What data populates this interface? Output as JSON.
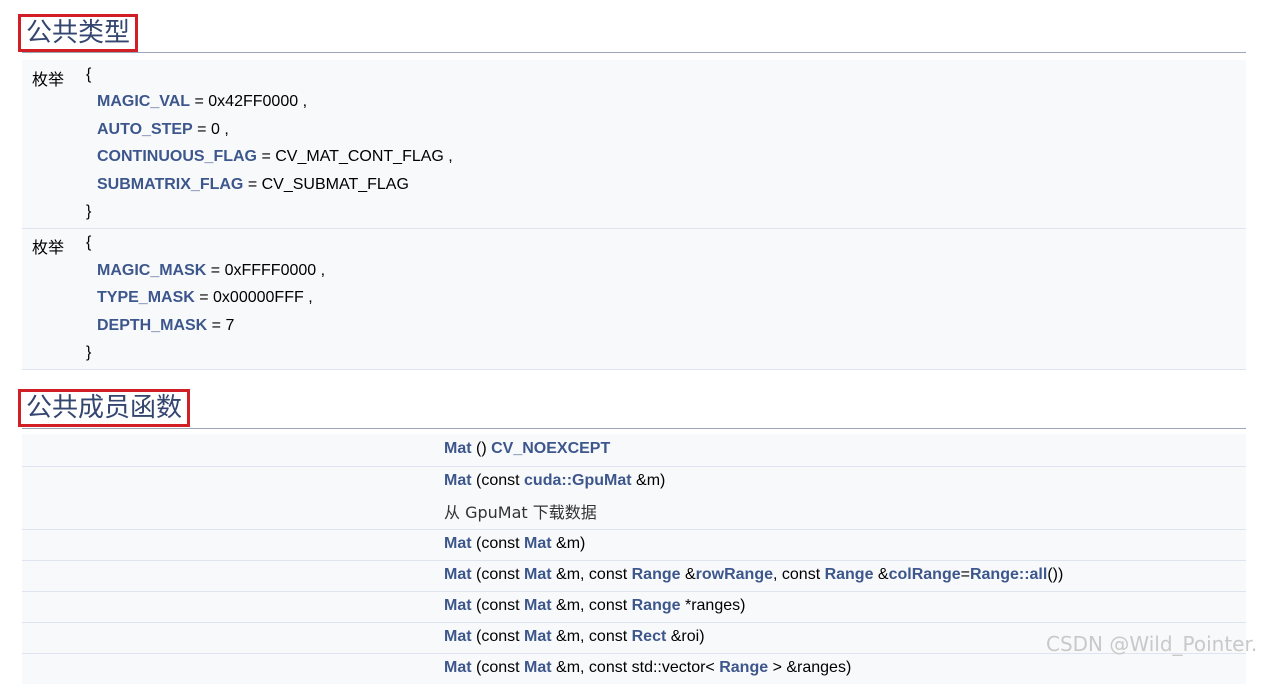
{
  "sections": {
    "types_title": "公共类型",
    "functions_title": "公共成员函数"
  },
  "enum1": {
    "keyword": "枚举",
    "open": "{",
    "close": "}",
    "items": [
      {
        "name": "MAGIC_VAL",
        "rest": " = 0x42FF0000 ,"
      },
      {
        "name": "AUTO_STEP",
        "rest": " = 0 ,"
      },
      {
        "name": "CONTINUOUS_FLAG",
        "rest": " = CV_MAT_CONT_FLAG ,"
      },
      {
        "name": "SUBMATRIX_FLAG",
        "rest": " = CV_SUBMAT_FLAG"
      }
    ]
  },
  "enum2": {
    "keyword": "枚举",
    "open": "{",
    "close": "}",
    "items": [
      {
        "name": "MAGIC_MASK",
        "rest": " = 0xFFFF0000 ,"
      },
      {
        "name": "TYPE_MASK",
        "rest": " = 0x00000FFF ,"
      },
      {
        "name": "DEPTH_MASK",
        "rest": " = 7"
      }
    ]
  },
  "functions": {
    "rows": [
      {
        "parts": [
          [
            "Mat",
            true
          ],
          [
            " () ",
            false
          ],
          [
            "CV_NOEXCEPT",
            true
          ]
        ]
      },
      {
        "parts": [
          [
            "Mat",
            true
          ],
          [
            " (const ",
            false
          ],
          [
            "cuda::GpuMat",
            true
          ],
          [
            " &m)",
            false
          ]
        ],
        "desc": "从 GpuMat 下载数据"
      },
      {
        "parts": [
          [
            "Mat",
            true
          ],
          [
            " (const ",
            false
          ],
          [
            "Mat",
            true
          ],
          [
            " &m)",
            false
          ]
        ]
      },
      {
        "parts": [
          [
            "Mat",
            true
          ],
          [
            " (const ",
            false
          ],
          [
            "Mat",
            true
          ],
          [
            " &m, const ",
            false
          ],
          [
            "Range",
            true
          ],
          [
            " &",
            false
          ],
          [
            "rowRange",
            true
          ],
          [
            ", const ",
            false
          ],
          [
            "Range",
            true
          ],
          [
            " &",
            false
          ],
          [
            "colRange",
            true
          ],
          [
            "=",
            false
          ],
          [
            "Range::all",
            true
          ],
          [
            "())",
            false
          ]
        ]
      },
      {
        "parts": [
          [
            "Mat",
            true
          ],
          [
            " (const ",
            false
          ],
          [
            "Mat",
            true
          ],
          [
            " &m, const ",
            false
          ],
          [
            "Range",
            true
          ],
          [
            " *ranges)",
            false
          ]
        ]
      },
      {
        "parts": [
          [
            "Mat",
            true
          ],
          [
            " (const ",
            false
          ],
          [
            "Mat",
            true
          ],
          [
            " &m, const ",
            false
          ],
          [
            "Rect",
            true
          ],
          [
            " &roi)",
            false
          ]
        ]
      },
      {
        "parts": [
          [
            "Mat",
            true
          ],
          [
            " (const ",
            false
          ],
          [
            "Mat",
            true
          ],
          [
            " &m, const std::vector< ",
            false
          ],
          [
            "Range",
            true
          ],
          [
            " > &ranges)",
            false
          ]
        ]
      }
    ]
  },
  "watermark": "CSDN @Wild_Pointer."
}
